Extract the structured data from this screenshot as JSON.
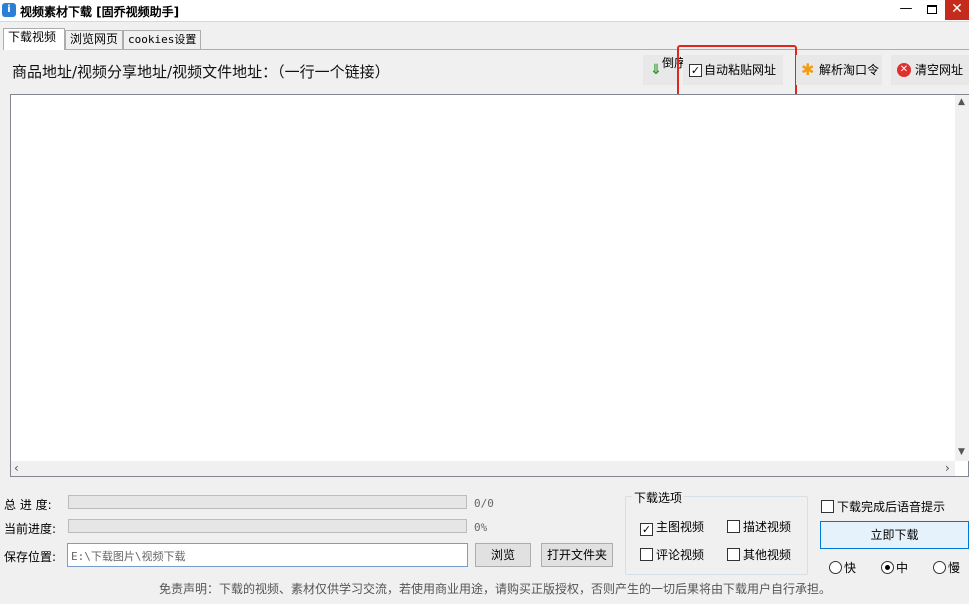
{
  "window": {
    "title": "视频素材下载 [固乔视频助手]",
    "app_icon": "i",
    "minimize_glyph": "—",
    "close_glyph": "✕"
  },
  "tabs": [
    {
      "label": "下载视频",
      "active": true
    },
    {
      "label": "浏览网页",
      "active": false
    },
    {
      "label": "cookies设置",
      "active": false
    }
  ],
  "url_section": {
    "label": "商品地址/视频分享地址/视频文件地址：（一行一个链接）",
    "textarea_value": ""
  },
  "toolbar": {
    "reverse": {
      "label": "倒序",
      "icon": "down-arrow-icon",
      "glyph": "⇓"
    },
    "auto_paste": {
      "label": "自动粘贴网址",
      "checked": true,
      "check_glyph": "✓"
    },
    "parse_taokouling": {
      "label": "解析淘口令",
      "icon": "asterisk-icon",
      "glyph": "✱"
    },
    "clear_urls": {
      "label": "清空网址",
      "icon": "clear-x-icon",
      "glyph": "✕"
    }
  },
  "highlight_color": "#e0261f",
  "progress": {
    "total": {
      "label": "总 进 度:",
      "text": "0/0",
      "fraction": 0
    },
    "current": {
      "label": "当前进度:",
      "text": "0%",
      "fraction": 0
    }
  },
  "save": {
    "label": "保存位置:",
    "path": "E:\\下载图片\\视频下载",
    "browse_label": "浏览",
    "open_folder_label": "打开文件夹"
  },
  "download_options": {
    "title": "下载选项",
    "check_glyph": "✓",
    "items": [
      {
        "label": "主图视频",
        "checked": true
      },
      {
        "label": "描述视频",
        "checked": false
      },
      {
        "label": "评论视频",
        "checked": false
      },
      {
        "label": "其他视频",
        "checked": false
      }
    ]
  },
  "voice_prompt": {
    "label": "下载完成后语音提示",
    "checked": false
  },
  "download_now_label": "立即下载",
  "speed": {
    "selected": "中",
    "options": [
      {
        "label": "快",
        "selected": false
      },
      {
        "label": "中",
        "selected": true
      },
      {
        "label": "慢",
        "selected": false
      }
    ]
  },
  "disclaimer": "免责声明：下载的视频、素材仅供学习交流，若使用商业用途，请购买正版授权，否则产生的一切后果将由下载用户自行承担。"
}
